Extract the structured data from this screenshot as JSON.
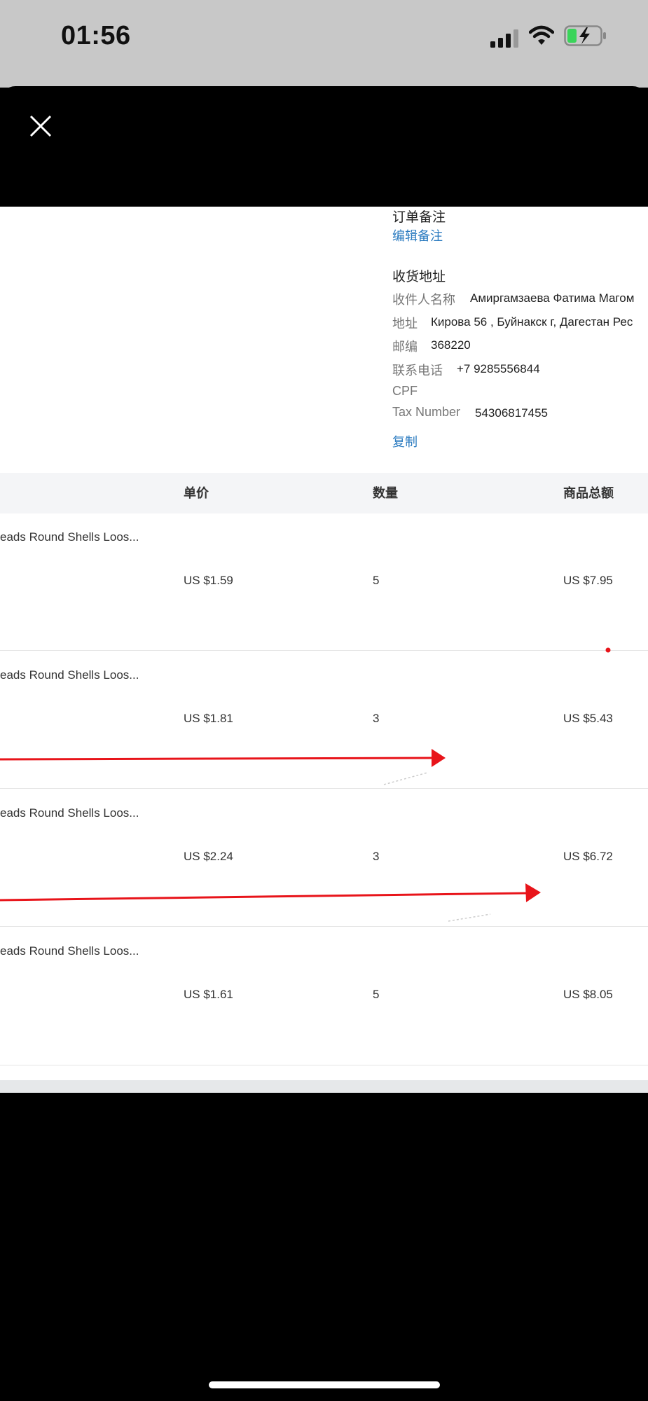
{
  "status_bar": {
    "time": "01:56"
  },
  "order_note": {
    "heading": "订单备注",
    "edit_link": "编辑备注"
  },
  "shipping": {
    "heading": "收货地址",
    "recipient_label": "收件人名称",
    "recipient_value": "Амиргамзаева Фатима Магом",
    "address_label": "地址",
    "address_value": "Кирова 56 , Буйнакск г, Дагестан Рес",
    "zip_label": "邮编",
    "zip_value": "368220",
    "phone_label": "联系电话",
    "phone_value": "+7 9285556844",
    "cpf_label": "CPF",
    "tax_label": "Tax Number",
    "tax_value": "54306817455",
    "copy_link": "复制"
  },
  "table": {
    "headers": [
      "单价",
      "数量",
      "商品总额"
    ],
    "rows": [
      {
        "product": "eads Round Shells Loos...",
        "price": "US $1.59",
        "qty": "5",
        "total": "US $7.95"
      },
      {
        "product": "eads Round Shells Loos...",
        "price": "US $1.81",
        "qty": "3",
        "total": "US $5.43"
      },
      {
        "product": "eads Round Shells Loos...",
        "price": "US $2.24",
        "qty": "3",
        "total": "US $6.72"
      },
      {
        "product": "eads Round Shells Loos...",
        "price": "US $1.61",
        "qty": "5",
        "total": "US $8.05"
      }
    ]
  },
  "colors": {
    "link": "#2b7bc0",
    "annotation_arrow": "#e8141a",
    "status_bar_bg": "#c8c8c8",
    "battery_fill": "#3ad45a"
  },
  "icons": [
    "close-icon",
    "signal-icon",
    "wifi-icon",
    "battery-charging-icon",
    "arrow-annotation"
  ]
}
